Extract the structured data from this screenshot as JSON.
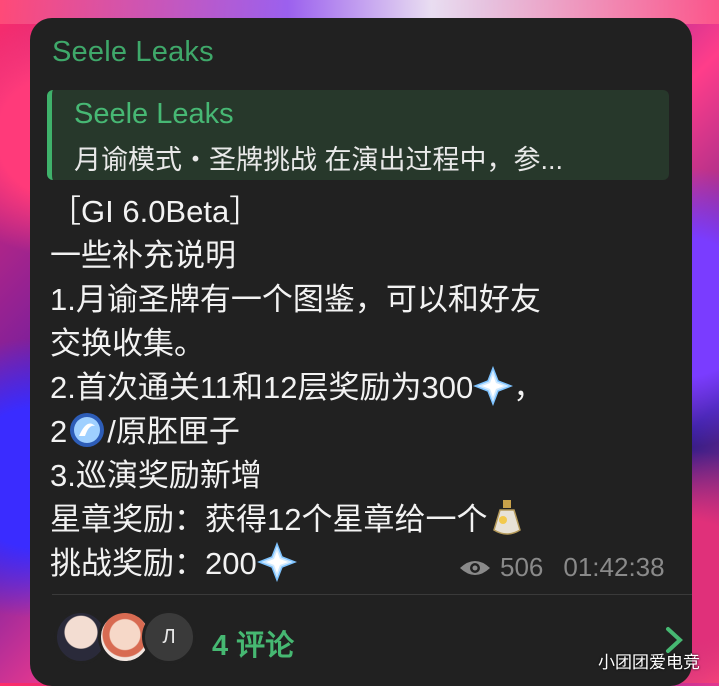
{
  "post": {
    "sender": "Seele Leaks",
    "reply": {
      "name": "Seele Leaks",
      "text": "月谕模式・圣牌挑战 在演出过程中，参..."
    },
    "lines": {
      "l1": "［GI 6.0Beta］",
      "l2": "一些补充说明",
      "l3": "1.月谕圣牌有一个图鉴，可以和好友",
      "l4": "交换收集。",
      "l5a": "2.首次通关11和12层奖励为300",
      "l5b": "，",
      "l6a": "2",
      "l6b": "/原胚匣子",
      "l7": "3.巡演奖励新增",
      "l8": "星章奖励：获得12个星章给一个",
      "l9": "挑战奖励：200"
    },
    "views": "506",
    "time": "01:42:38"
  },
  "comments": {
    "avatar3_initial": "Л",
    "label": "4 评论"
  },
  "watermark": "小团团爱电竞",
  "icons": {
    "gem": "primogem-icon",
    "fate": "fate-icon",
    "vial": "vial-icon",
    "views": "eye-icon",
    "chevron": "chevron-right-icon"
  },
  "colors": {
    "accent": "#3fa86a",
    "bubble": "#212121"
  }
}
